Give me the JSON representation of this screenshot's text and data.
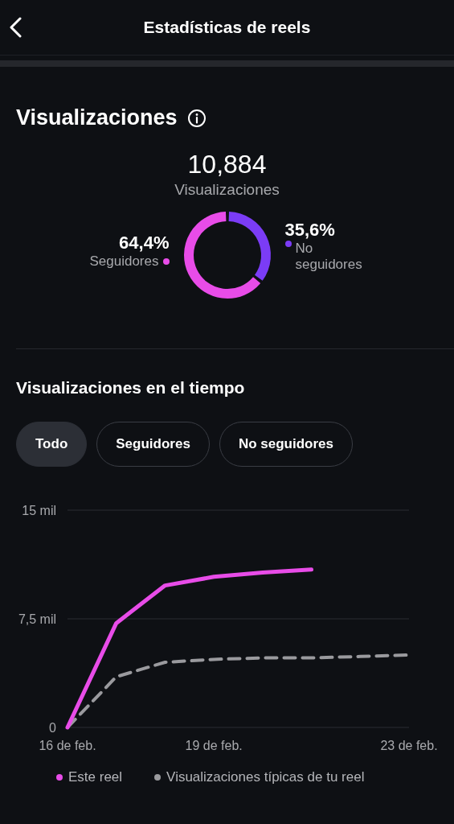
{
  "header": {
    "title": "Estadísticas de reels"
  },
  "views": {
    "title": "Visualizaciones",
    "total": "10,884",
    "total_label": "Visualizaciones",
    "segments": [
      {
        "percent": "64,4%",
        "label": "Seguidores",
        "color": "#e84ce8"
      },
      {
        "percent": "35,6%",
        "label": "No seguidores",
        "color": "#7b3cf6"
      }
    ]
  },
  "over_time": {
    "title": "Visualizaciones en el tiempo",
    "filters": [
      {
        "label": "Todo",
        "selected": true
      },
      {
        "label": "Seguidores",
        "selected": false
      },
      {
        "label": "No seguidores",
        "selected": false
      }
    ],
    "chart_data": {
      "type": "line",
      "categories": [
        "16 de feb.",
        null,
        null,
        "19 de feb.",
        null,
        null,
        null,
        "23 de feb."
      ],
      "ylim": [
        0,
        15
      ],
      "yticks": [
        {
          "value": 0,
          "label": "0"
        },
        {
          "value": 7.5,
          "label": "7,5 mil"
        },
        {
          "value": 15,
          "label": "15 mil"
        }
      ],
      "series": [
        {
          "name": "Este reel",
          "color": "#e84ce8",
          "line_style": "solid",
          "values": [
            0,
            7.2,
            9.8,
            10.4,
            10.7,
            10.9,
            null,
            null
          ]
        },
        {
          "name": "Visualizaciones típicas de tu reel",
          "color": "#9a9a9e",
          "line_style": "dashed",
          "values": [
            0,
            3.5,
            4.5,
            4.7,
            4.8,
            4.8,
            4.9,
            5.0
          ]
        }
      ]
    }
  }
}
